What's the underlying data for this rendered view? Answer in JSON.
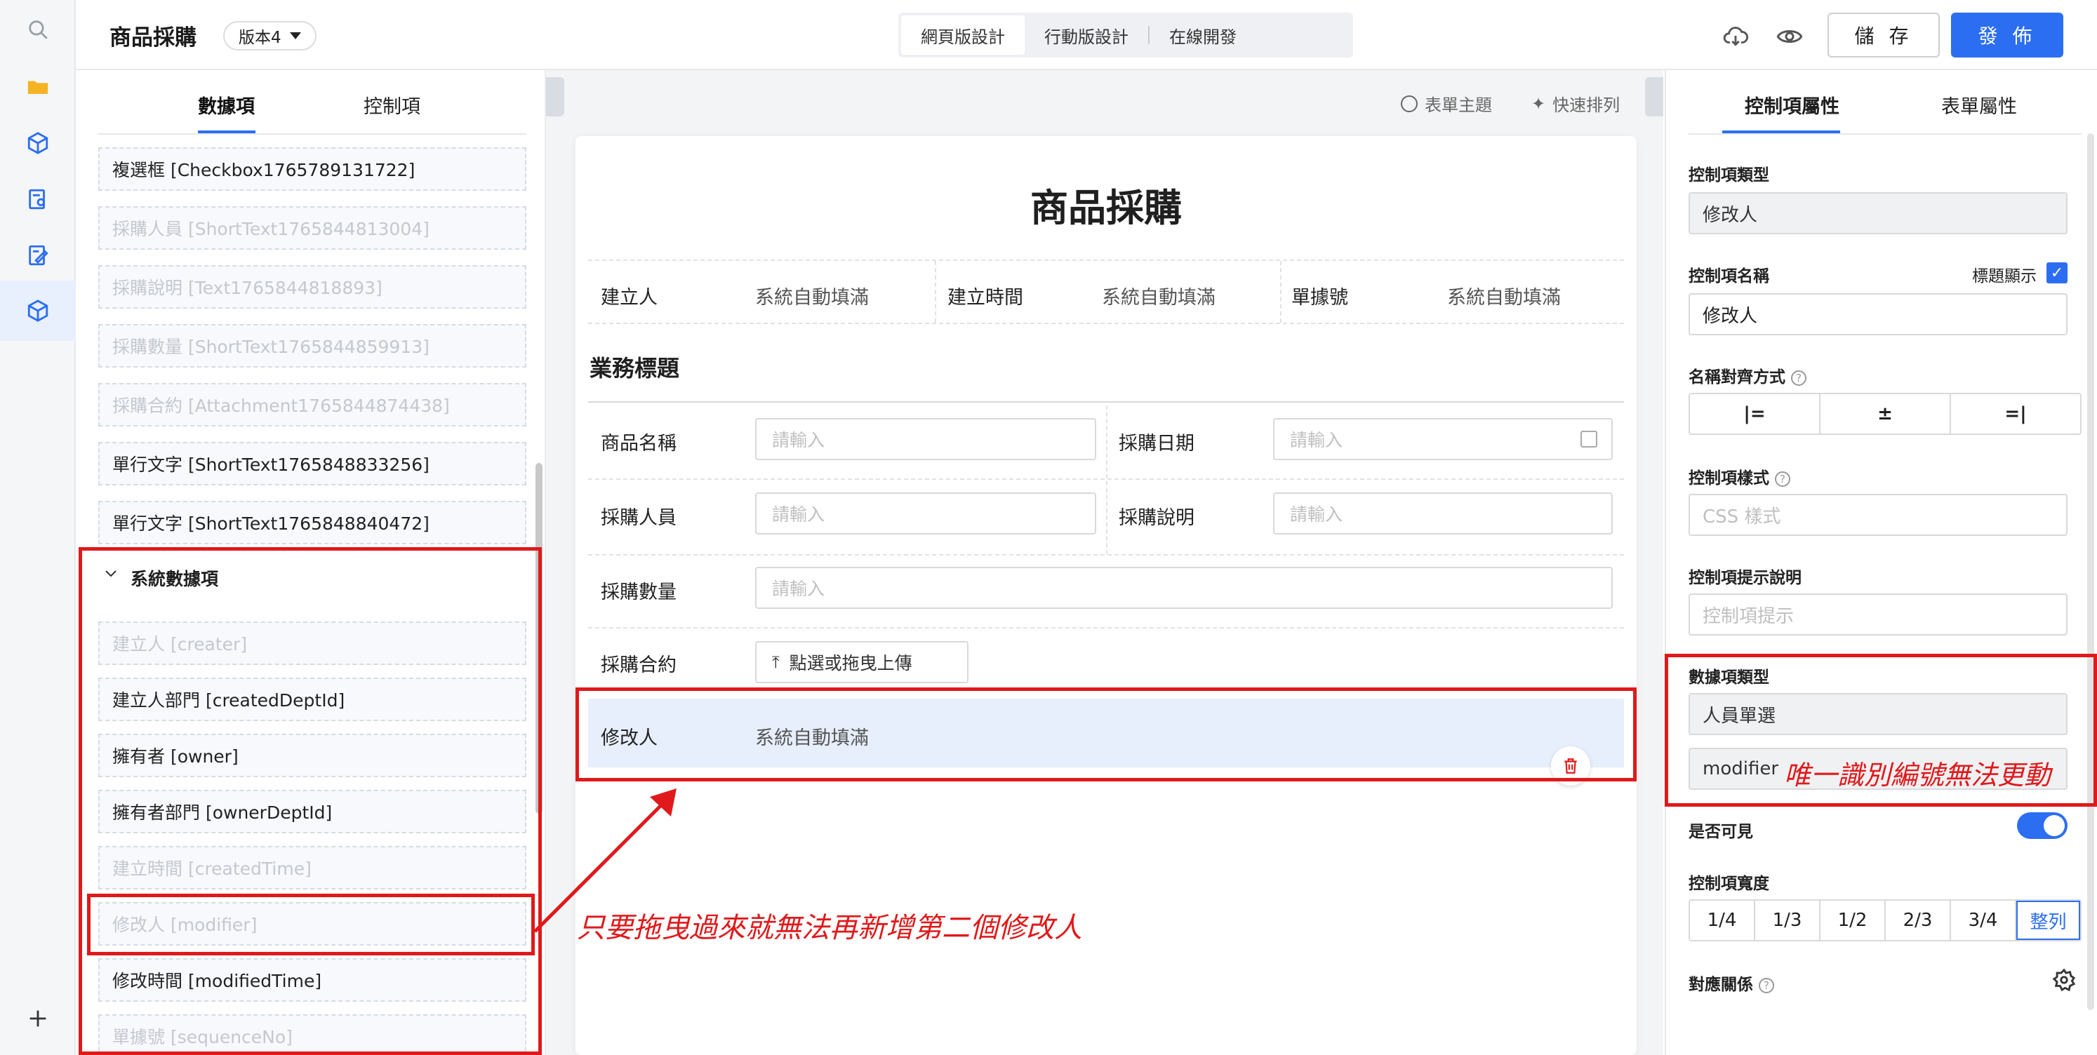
{
  "topbar": {
    "title": "商品採購",
    "version": "版本4",
    "modes": [
      "網頁版設計",
      "行動版設計",
      "在線開發"
    ],
    "save": "儲 存",
    "publish": "發 佈"
  },
  "left_panel": {
    "tabs": [
      "數據項",
      "控制項"
    ],
    "items_top": [
      {
        "label": "複選框 [Checkbox1765789131722]",
        "disabled": false
      },
      {
        "label": "採購人員 [ShortText1765844813004]",
        "disabled": true
      },
      {
        "label": "採購說明 [Text1765844818893]",
        "disabled": true
      },
      {
        "label": "採購數量 [ShortText1765844859913]",
        "disabled": true
      },
      {
        "label": "採購合約 [Attachment1765844874438]",
        "disabled": true
      },
      {
        "label": "單行文字 [ShortText1765848833256]",
        "disabled": false
      },
      {
        "label": "單行文字 [ShortText1765848840472]",
        "disabled": false
      }
    ],
    "group_title": "系統數據項",
    "items_system": [
      {
        "label": "建立人 [creater]",
        "disabled": true
      },
      {
        "label": "建立人部門 [createdDeptId]",
        "disabled": false
      },
      {
        "label": "擁有者 [owner]",
        "disabled": false
      },
      {
        "label": "擁有者部門 [ownerDeptId]",
        "disabled": false
      },
      {
        "label": "建立時間 [createdTime]",
        "disabled": true
      },
      {
        "label": "修改人 [modifier]",
        "disabled": true
      },
      {
        "label": "修改時間 [modifiedTime]",
        "disabled": false
      },
      {
        "label": "單據號 [sequenceNo]",
        "disabled": true
      }
    ]
  },
  "canvas": {
    "form_theme": "表單主題",
    "quick_arrange": "快速排列",
    "form_title": "商品採購",
    "header_fields": [
      {
        "label": "建立人",
        "value": "系統自動填滿"
      },
      {
        "label": "建立時間",
        "value": "系統自動填滿"
      },
      {
        "label": "單據號",
        "value": "系統自動填滿"
      }
    ],
    "section_title": "業務標題",
    "rows": {
      "product_name": {
        "label": "商品名稱",
        "placeholder": "請輸入"
      },
      "purchase_date": {
        "label": "採購日期",
        "placeholder": "請輸入"
      },
      "purchaser": {
        "label": "採購人員",
        "placeholder": "請輸入"
      },
      "description": {
        "label": "採購說明",
        "placeholder": "請輸入"
      },
      "quantity": {
        "label": "採購數量",
        "placeholder": "請輸入"
      },
      "contract": {
        "label": "採購合約",
        "upload": "點選或拖曳上傳"
      },
      "modifier": {
        "label": "修改人",
        "value": "系統自動填滿"
      }
    }
  },
  "right_panel": {
    "tabs": [
      "控制項屬性",
      "表單屬性"
    ],
    "control_type_label": "控制項類型",
    "control_type_value": "修改人",
    "control_name_label": "控制項名稱",
    "show_title_label": "標題顯示",
    "control_name_value": "修改人",
    "align_label": "名稱對齊方式",
    "style_label": "控制項樣式",
    "style_placeholder": "CSS 樣式",
    "hint_label": "控制項提示說明",
    "hint_placeholder": "控制項提示",
    "data_type_label": "數據項類型",
    "data_type_value": "人員單選",
    "data_id_value": "modifier",
    "visible_label": "是否可見",
    "width_label": "控制項寬度",
    "width_options": [
      "1/4",
      "1/3",
      "1/2",
      "2/3",
      "3/4",
      "整列"
    ],
    "width_selected": "整列",
    "mapping_label": "對應關係"
  },
  "annotations": {
    "id_note": "唯一識別編號無法更動",
    "drag_note": "只要拖曳過來就無法再新增第二個修改人"
  },
  "colors": {
    "accent": "#2b6ef2",
    "annotation_red": "#e0191b"
  }
}
